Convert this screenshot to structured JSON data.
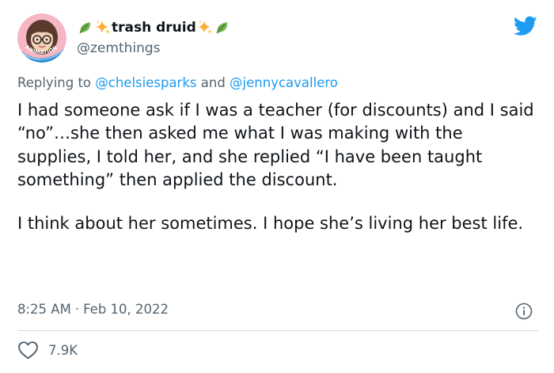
{
  "tweet": {
    "author": {
      "display_name": "trash druid",
      "handle": "@zemthings",
      "avatar_badge": "ANIMATION",
      "name_emojis": [
        "leaf-icon",
        "sparkles-icon",
        "sparkles-icon",
        "leaf-icon"
      ]
    },
    "reply": {
      "prefix": "Replying to ",
      "mention_1": "@chelsiesparks",
      "conjunction": " and ",
      "mention_2": "@jennycavallero"
    },
    "body": {
      "paragraph_1": "I had someone ask if I was a teacher (for discounts) and I said “no”…she then asked me what I was making with the supplies, I told her, and she replied “I have been taught something” then applied the discount.",
      "paragraph_2": "I think about her sometimes. I hope she’s living her best life."
    },
    "time": "8:25 AM",
    "separator": "·",
    "date": "Feb 10, 2022",
    "likes": "7.9K"
  },
  "icons": {
    "platform": "twitter-bird-icon",
    "info": "info-icon",
    "like": "heart-icon"
  },
  "colors": {
    "text_primary": "#0f1419",
    "text_secondary": "#536471",
    "accent": "#1d9bf0",
    "divider": "#cfd9de"
  }
}
